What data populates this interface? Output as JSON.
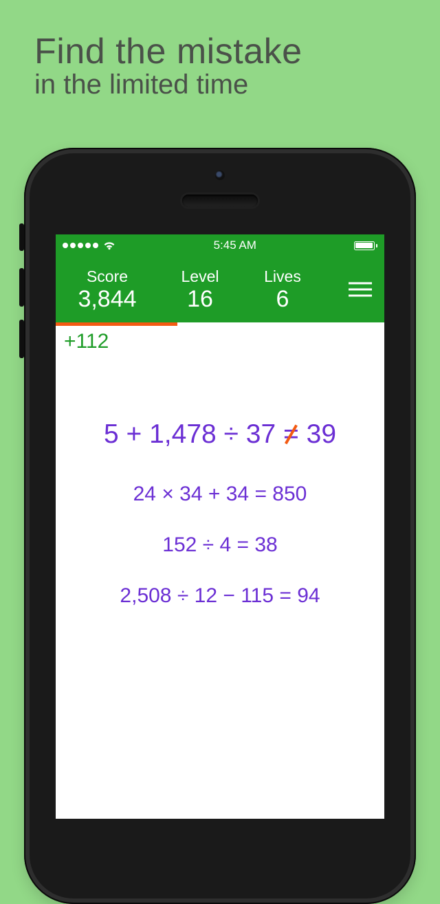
{
  "tagline": {
    "line1": "Find the mistake",
    "line2": "in the limited time"
  },
  "status": {
    "time": "5:45 AM"
  },
  "header": {
    "score_label": "Score",
    "score_value": "3,844",
    "level_label": "Level",
    "level_value": "16",
    "lives_label": "Lives",
    "lives_value": "6"
  },
  "bonus": "+112",
  "equations": {
    "eq1_left": "5 + 1,478 ÷ 37 ",
    "eq1_sym": "=",
    "eq1_right": " 39",
    "eq2": "24 × 34 + 34 = 850",
    "eq3": "152 ÷ 4 = 38",
    "eq4": "2,508 ÷ 12 − 115 = 94"
  }
}
